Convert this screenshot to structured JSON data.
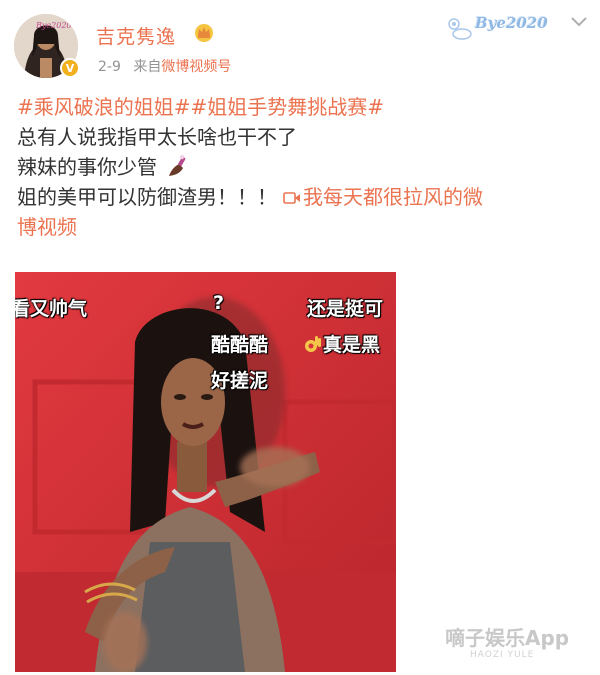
{
  "header": {
    "username": "吉克隽逸",
    "date": "2-9",
    "source_prefix": "来自",
    "source": "微博视频号",
    "card_decoration": "Bye2020",
    "vip_badge": "V"
  },
  "post": {
    "hashtags": [
      "#乘风破浪的姐姐#",
      "#姐姐手势舞挑战赛#"
    ],
    "lines": [
      "总有人说我指甲太长啥也干不了",
      "辣妹的事你少管",
      "姐的美甲可以防御渣男！！！"
    ],
    "video_link_part1": "我每天都很拉风的微",
    "video_link_part2": "博视频",
    "emojis": [
      "nail-polish-icon"
    ]
  },
  "video": {
    "captions": {
      "left": "看又帅气",
      "question": "?",
      "right": "还是挺可",
      "cool": "酷酷酷",
      "black": "真是黑",
      "scrub": "好搓泥"
    }
  },
  "watermark": {
    "main": "嘀子娱乐App",
    "sub": "HAOZI YULE"
  },
  "colors": {
    "accent": "#eb7350",
    "text": "#333333",
    "meta": "#939393",
    "video_bg": "#d8343a"
  }
}
